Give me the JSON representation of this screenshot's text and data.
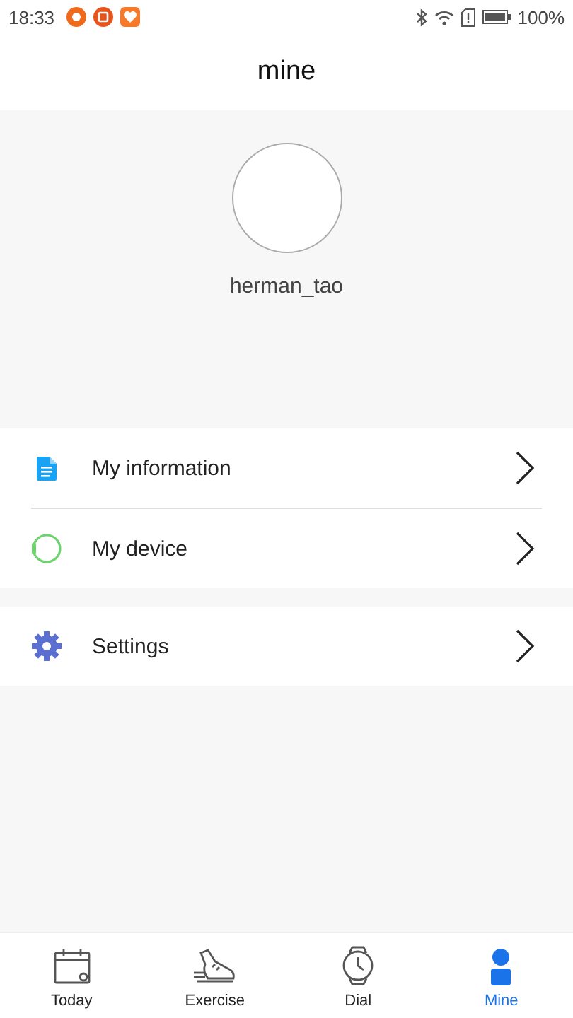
{
  "status_bar": {
    "time": "18:33",
    "battery": "100%"
  },
  "header": {
    "title": "mine"
  },
  "profile": {
    "username": "herman_tao"
  },
  "menu_groups": [
    [
      {
        "label": "My information",
        "kind": "info"
      },
      {
        "label": "My device",
        "kind": "device"
      }
    ],
    [
      {
        "label": "Settings",
        "kind": "settings"
      }
    ]
  ],
  "tabs": [
    {
      "label": "Today",
      "kind": "today",
      "selected": false
    },
    {
      "label": "Exercise",
      "kind": "exercise",
      "selected": false
    },
    {
      "label": "Dial",
      "kind": "dial",
      "selected": false
    },
    {
      "label": "Mine",
      "kind": "mine",
      "selected": true
    }
  ]
}
